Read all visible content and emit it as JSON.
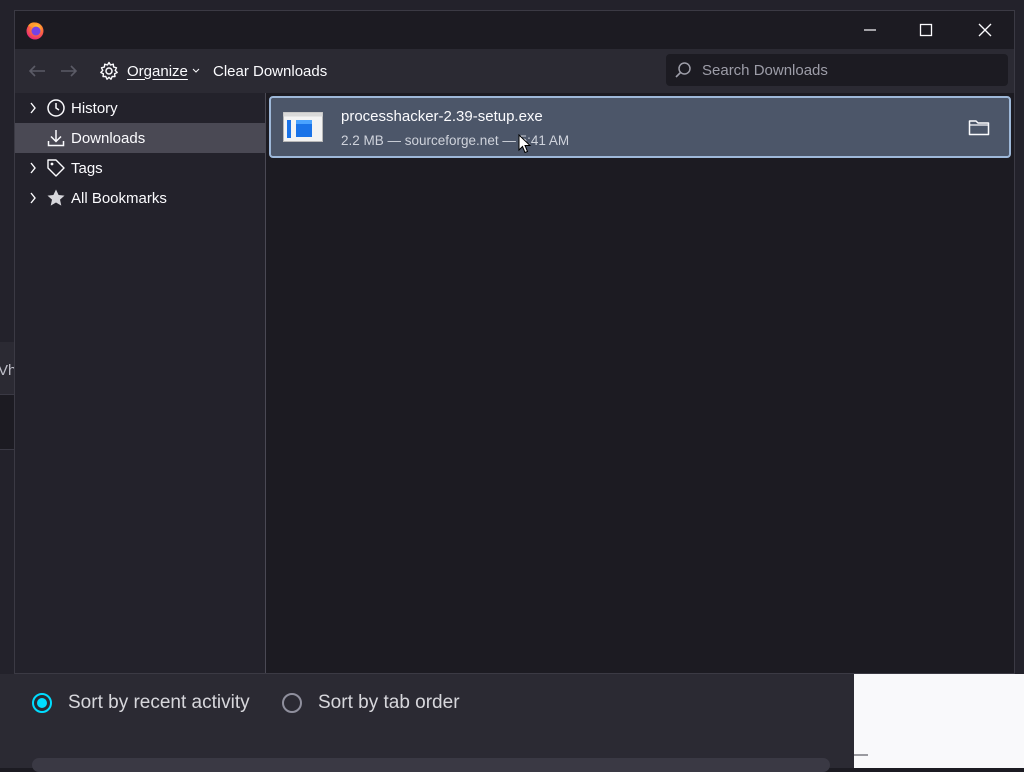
{
  "background": {
    "partial_text": "Vha",
    "sort_options": [
      {
        "label": "Sort by recent activity",
        "selected": true
      },
      {
        "label": "Sort by tab order",
        "selected": false
      }
    ]
  },
  "window": {
    "controls": [
      "minimize-icon",
      "maximize-icon",
      "close-icon"
    ]
  },
  "toolbar": {
    "back_icon": "back-arrow-icon",
    "forward_icon": "forward-arrow-icon",
    "organize_label": "Organize",
    "clear_label": "Clear Downloads",
    "search_placeholder": "Search Downloads"
  },
  "sidebar": {
    "items": [
      {
        "label": "History",
        "icon": "clock-icon",
        "expandable": true,
        "selected": false
      },
      {
        "label": "Downloads",
        "icon": "download-icon",
        "expandable": false,
        "selected": true
      },
      {
        "label": "Tags",
        "icon": "tag-icon",
        "expandable": true,
        "selected": false
      },
      {
        "label": "All Bookmarks",
        "icon": "star-icon",
        "expandable": true,
        "selected": false
      }
    ]
  },
  "downloads": [
    {
      "filename": "processhacker-2.39-setup.exe",
      "meta": "2.2 MB — sourceforge.net — 5:41 AM",
      "icon": "exe-file-icon",
      "action_icon": "folder-icon"
    }
  ],
  "colors": {
    "accent_radio": "#00ddff",
    "selected_row": "#4c5669",
    "selected_row_border": "#9eb8d9"
  }
}
